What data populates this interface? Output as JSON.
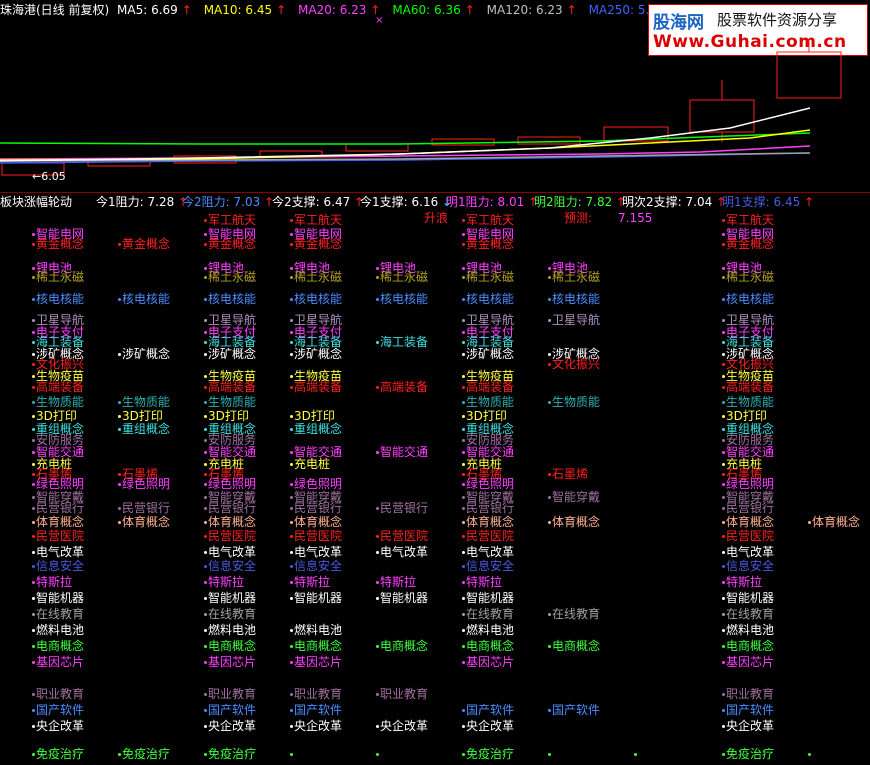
{
  "colors": {
    "background": "#000000",
    "divider": "#8b0000",
    "k_border": "#ff2020",
    "ma5": "#ffffff",
    "ma10": "#ffff00",
    "ma20": "#ff40ff",
    "ma60": "#00ff00",
    "ma120": "#c0c0c0",
    "ma250": "#4060ff",
    "up_arrow": "#ff2020",
    "down_arrow": "#00ffff"
  },
  "ma_header": {
    "title": "珠海港(日线 前复权)",
    "ma5": "MA5: 6.69",
    "ma10": "MA10: 6.45",
    "ma20": "MA20: 6.23",
    "ma60": "MA60: 6.36",
    "ma120": "MA120: 6.23",
    "ma250": "MA250: 5.92",
    "up_arrow": "↑",
    "down_arrow": "↓",
    "marker": "×"
  },
  "watermark": {
    "name": "股海网",
    "slogan": "股票软件资源分享",
    "url": "Www.Guhai.com.cn"
  },
  "kline": {
    "low_label": "←6.05"
  },
  "sr_header": {
    "title": "板块涨幅轮动",
    "r1_today": "今1阻力: 7.28",
    "r2_today": "今2阻力: 7.03",
    "s2_today": "今2支撑: 6.47",
    "s1_today": "今1支撑: 6.16",
    "r1_tomorrow": "明1阻力: 8.01",
    "r2_tomorrow": "明2阻力: 7.82",
    "s2_next": "明次2支撑: 7.04",
    "s1_tomorrow": "明1支撑: 6.45"
  },
  "annotations": {
    "rise": "升浪",
    "forecast_label": "预测:",
    "forecast_value": "7.155"
  },
  "sectors": [
    {
      "name": "军工航天",
      "color": "#ff2020"
    },
    {
      "name": "智能电网",
      "color": "#ff40ff"
    },
    {
      "name": "黄金概念",
      "color": "#ff2020"
    },
    {
      "name": "锂电池",
      "color": "#ff40ff"
    },
    {
      "name": "稀土永磁",
      "color": "#b0a020"
    },
    {
      "name": "核电核能",
      "color": "#4a8cff"
    },
    {
      "name": "卫星导航",
      "color": "#b090c0"
    },
    {
      "name": "电子支付",
      "color": "#ff40ff"
    },
    {
      "name": "海工装备",
      "color": "#40e0e0"
    },
    {
      "name": "涉矿概念",
      "color": "#ffffff"
    },
    {
      "name": "文化振兴",
      "color": "#ff2020"
    },
    {
      "name": "生物疫苗",
      "color": "#ffff40"
    },
    {
      "name": "高端装备",
      "color": "#ff2020"
    },
    {
      "name": "生物质能",
      "color": "#30b0b0"
    },
    {
      "name": "3D打印",
      "color": "#ffff40"
    },
    {
      "name": "重组概念",
      "color": "#40e0e0"
    },
    {
      "name": "安防服务",
      "color": "#a070a0"
    },
    {
      "name": "智能交通",
      "color": "#ff40ff"
    },
    {
      "name": "充电桩",
      "color": "#ffff40"
    },
    {
      "name": "石墨烯",
      "color": "#ff2020"
    },
    {
      "name": "绿色照明",
      "color": "#ff40ff"
    },
    {
      "name": "智能穿戴",
      "color": "#a070a0"
    },
    {
      "name": "民营银行",
      "color": "#a070a0"
    },
    {
      "name": "体育概念",
      "color": "#ffb090"
    },
    {
      "name": "民营医院",
      "color": "#ff2020"
    },
    {
      "name": "电气改革",
      "color": "#ffffff"
    },
    {
      "name": "信息安全",
      "color": "#4a5ae0"
    },
    {
      "name": "特斯拉",
      "color": "#ff40ff"
    },
    {
      "name": "智能机器",
      "color": "#ffffff"
    },
    {
      "name": "在线教育",
      "color": "#a0a0a0"
    },
    {
      "name": "燃料电池",
      "color": "#ffffff"
    },
    {
      "name": "电商概念",
      "color": "#40ff40"
    },
    {
      "name": "基因芯片",
      "color": "#ff40ff"
    },
    {
      "name": "职业教育",
      "color": "#a070a0"
    },
    {
      "name": "国产软件",
      "color": "#4a8cff"
    },
    {
      "name": "央企改革",
      "color": "#ffffff"
    },
    {
      "name": "免疫治疗",
      "color": "#40ff40"
    }
  ]
}
